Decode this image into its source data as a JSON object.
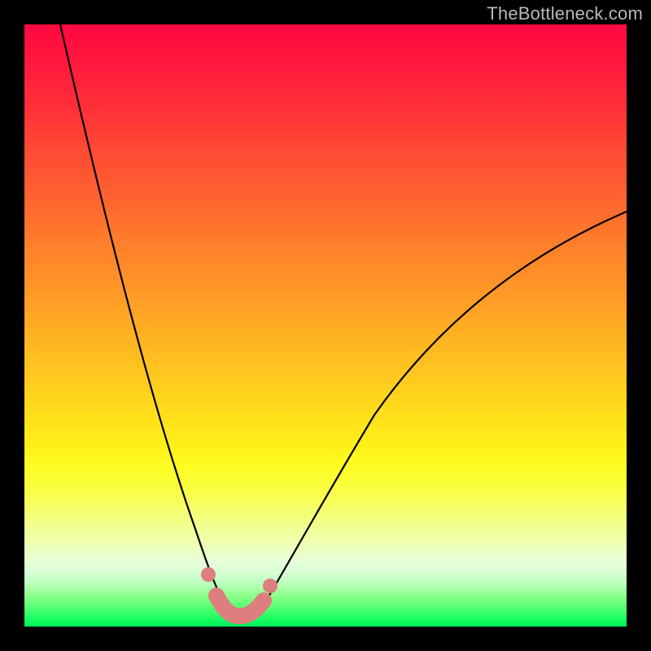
{
  "watermark": "TheBottleneck.com",
  "chart_data": {
    "type": "line",
    "title": "",
    "xlabel": "",
    "ylabel": "",
    "xlim": [
      0,
      100
    ],
    "ylim": [
      0,
      100
    ],
    "grid": false,
    "series": [
      {
        "name": "bottleneck-curve",
        "x": [
          6,
          8,
          10,
          12,
          14,
          16,
          18,
          20,
          22,
          24,
          26,
          28,
          30,
          31,
          32,
          33,
          34,
          35,
          36,
          37,
          38,
          40,
          42,
          44,
          46,
          50,
          55,
          60,
          65,
          70,
          75,
          80,
          85,
          90,
          95,
          100
        ],
        "values": [
          100,
          92,
          84,
          76,
          68,
          60,
          53,
          46,
          39,
          33,
          27,
          21,
          16,
          13,
          10,
          8,
          6,
          5,
          5,
          5,
          6,
          8,
          11,
          14,
          18,
          25,
          33,
          40,
          46,
          52,
          57,
          61,
          65,
          68,
          71,
          73
        ]
      }
    ],
    "markers": {
      "name": "highlight-dots",
      "color": "#dd7f7f",
      "x": [
        30,
        31,
        32,
        33,
        34,
        35,
        36,
        37,
        38
      ],
      "y": [
        16,
        9,
        6,
        5,
        5,
        5,
        5,
        6,
        12
      ]
    },
    "background_gradient": {
      "top": "#ff0840",
      "mid": "#ffe020",
      "bottom": "#00e858"
    }
  }
}
